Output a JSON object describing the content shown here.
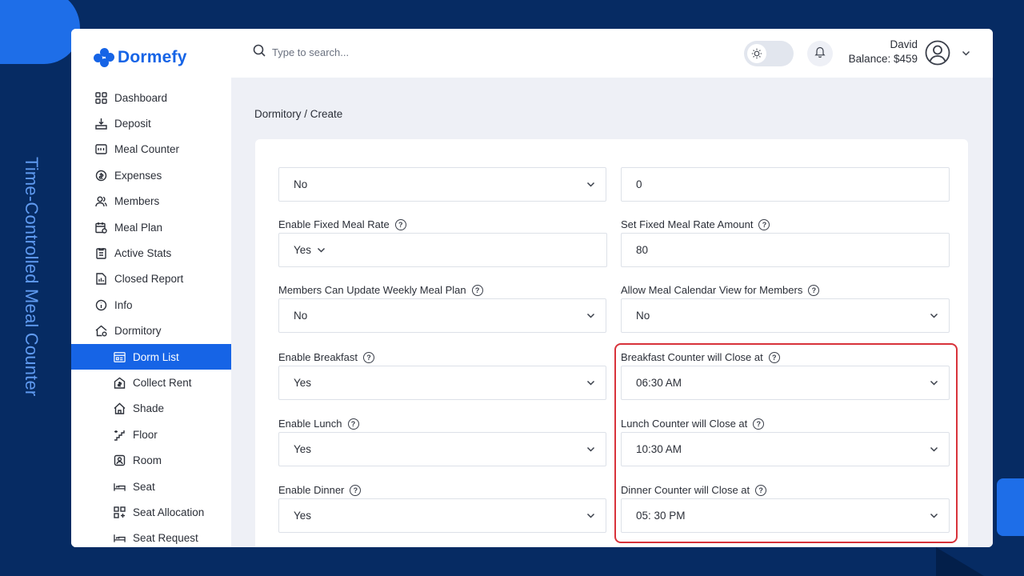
{
  "side_title": "Time-Controlled Meal Counter",
  "app": {
    "name": "Dormefy",
    "brand_color": "#1664e6"
  },
  "search": {
    "placeholder": "Type to search..."
  },
  "user": {
    "name": "David",
    "balance": "Balance: $459"
  },
  "sidebar": {
    "items": [
      {
        "label": "Dashboard",
        "icon": "dashboard-icon"
      },
      {
        "label": "Deposit",
        "icon": "deposit-icon"
      },
      {
        "label": "Meal Counter",
        "icon": "meal-counter-icon"
      },
      {
        "label": "Expenses",
        "icon": "expenses-icon"
      },
      {
        "label": "Members",
        "icon": "members-icon"
      },
      {
        "label": "Meal Plan",
        "icon": "meal-plan-icon"
      },
      {
        "label": "Active Stats",
        "icon": "active-stats-icon"
      },
      {
        "label": "Closed Report",
        "icon": "closed-report-icon"
      },
      {
        "label": "Info",
        "icon": "info-icon"
      },
      {
        "label": "Dormitory",
        "icon": "dormitory-icon"
      },
      {
        "label": "Dorm List",
        "icon": "dorm-list-icon",
        "active": true
      },
      {
        "label": "Collect Rent",
        "icon": "collect-rent-icon"
      },
      {
        "label": "Shade",
        "icon": "shade-icon"
      },
      {
        "label": "Floor",
        "icon": "floor-icon"
      },
      {
        "label": "Room",
        "icon": "room-icon"
      },
      {
        "label": "Seat",
        "icon": "seat-icon"
      },
      {
        "label": "Seat Allocation",
        "icon": "seat-allocation-icon"
      },
      {
        "label": "Seat Request",
        "icon": "seat-request-icon"
      }
    ]
  },
  "breadcrumb": "Dormitory / Create",
  "form": {
    "top_left_value": "No",
    "top_right_value": "0",
    "fixed_meal_rate": {
      "label": "Enable Fixed Meal Rate",
      "value": "Yes"
    },
    "fixed_meal_amount": {
      "label": "Set Fixed Meal Rate Amount",
      "value": "80"
    },
    "weekly_plan": {
      "label": "Members Can Update Weekly Meal Plan",
      "value": "No"
    },
    "calendar_view": {
      "label": "Allow Meal Calendar View for Members",
      "value": "No"
    },
    "breakfast": {
      "label": "Enable Breakfast",
      "value": "Yes"
    },
    "breakfast_close": {
      "label": "Breakfast Counter will Close at",
      "value": "06:30 AM"
    },
    "lunch": {
      "label": "Enable Lunch",
      "value": "Yes"
    },
    "lunch_close": {
      "label": "Lunch Counter will Close at",
      "value": "10:30 AM"
    },
    "dinner": {
      "label": "Enable Dinner",
      "value": "Yes"
    },
    "dinner_close": {
      "label": "Dinner Counter will Close at",
      "value": "05: 30 PM"
    }
  },
  "colors": {
    "background": "#062b63",
    "highlight": "#d8323a",
    "accent": "#1e6ee8"
  }
}
